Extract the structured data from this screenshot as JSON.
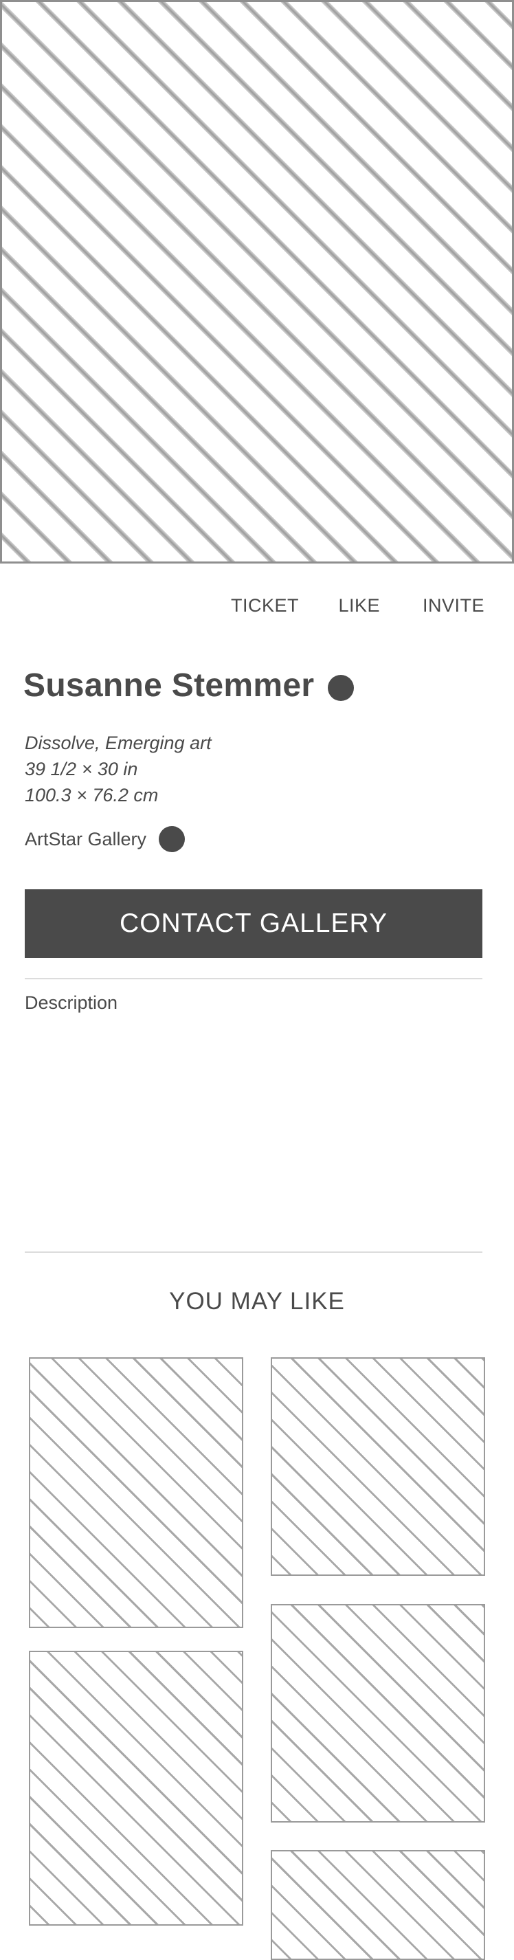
{
  "actions": {
    "ticket": "TICKET",
    "like": "LIKE",
    "invite": "INVITE"
  },
  "artwork": {
    "artist": "Susanne Stemmer",
    "title_line": "Dissolve, Emerging art",
    "size_in": "39 1/2 × 30 in",
    "size_cm": "100.3 × 76.2 cm",
    "gallery": "ArtStar Gallery"
  },
  "contact_button": "CONTACT GALLERY",
  "description_label": "Description",
  "you_may_like": {
    "title": "YOU MAY LIKE"
  },
  "colors": {
    "text": "#4a4a4a",
    "button_bg": "#4a4a4a",
    "button_text": "#ffffff",
    "divider": "#dcdcdc",
    "placeholder_stroke": "#9a9a9a"
  }
}
